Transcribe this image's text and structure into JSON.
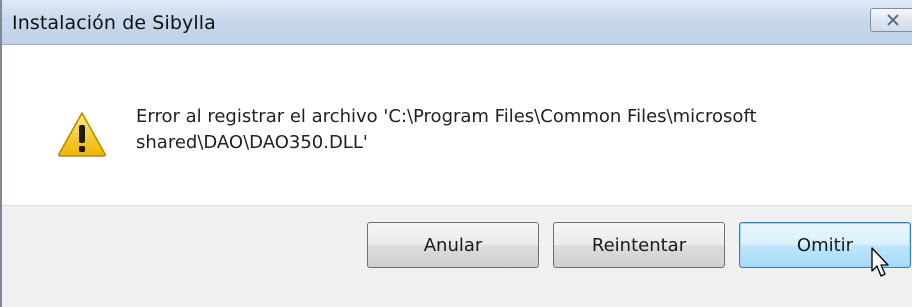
{
  "window": {
    "title": "Instalación de Sibylla",
    "close_icon": "close-icon"
  },
  "dialog": {
    "icon": "warning-icon",
    "message_line1": "Error al registrar el archivo 'C:\\Program Files\\Common Files\\microsoft",
    "message_line2": "shared\\DAO\\DAO350.DLL'"
  },
  "buttons": {
    "anular": "Anular",
    "reintentar": "Reintentar",
    "omitir": "Omitir"
  },
  "colors": {
    "titlebar": "#c9d9ec",
    "footer": "#f0f0f0",
    "warning": "#f5c518"
  }
}
